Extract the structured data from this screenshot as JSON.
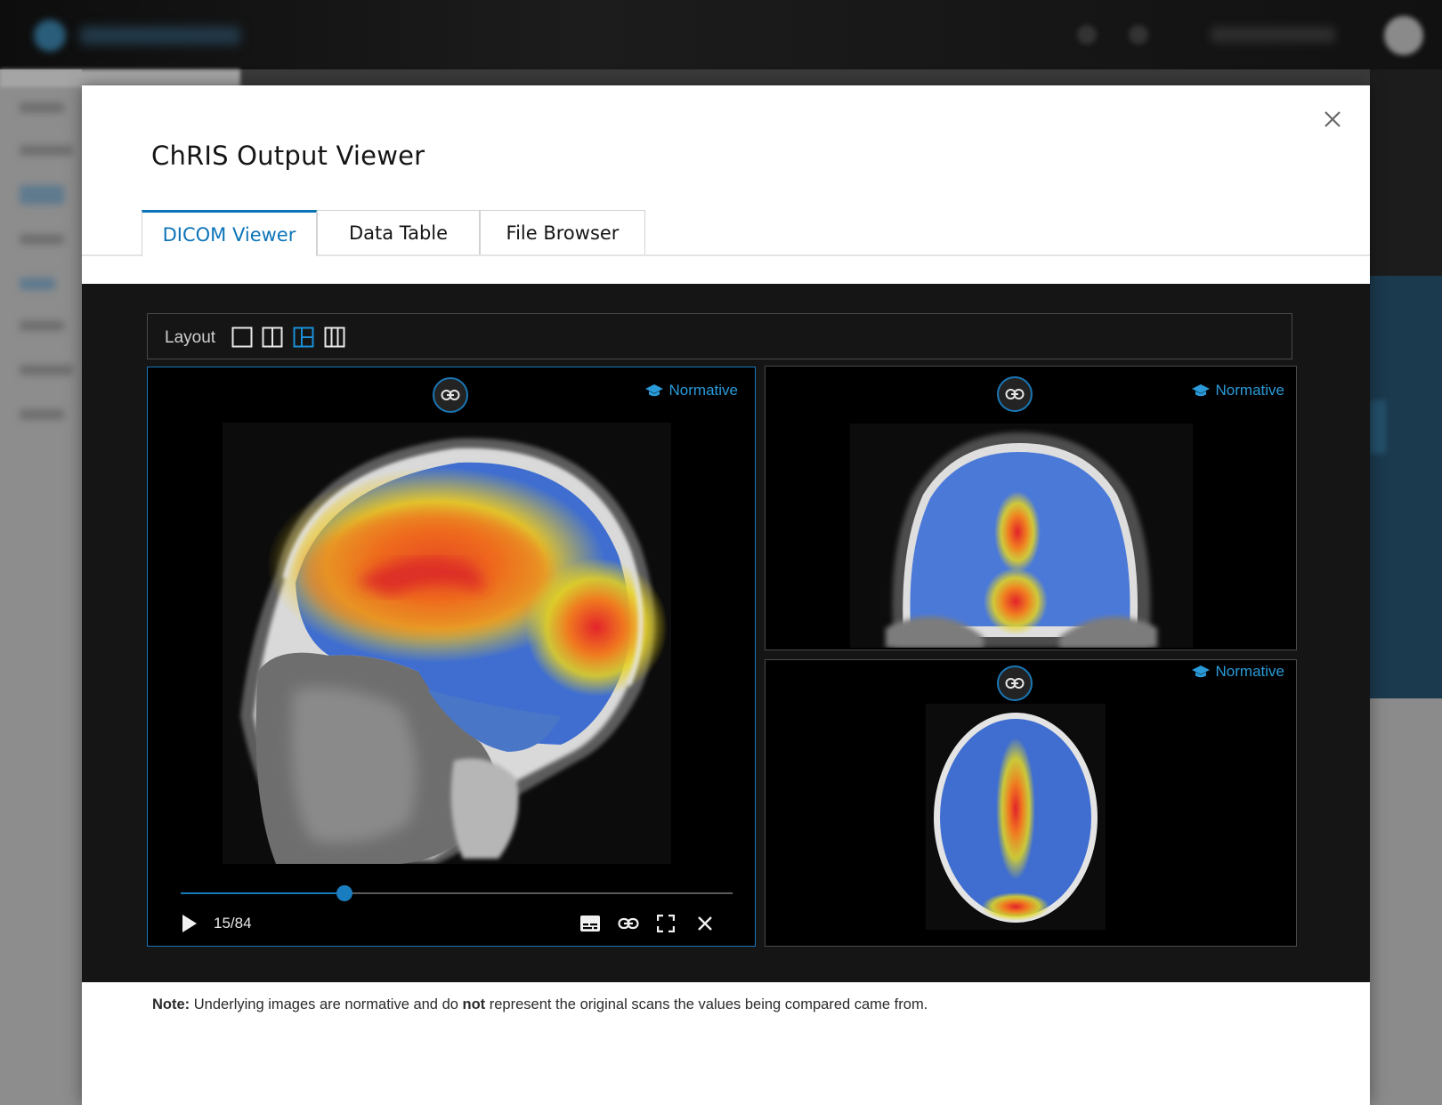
{
  "modal": {
    "title": "ChRIS Output Viewer",
    "close_icon": "close-icon"
  },
  "tabs": [
    {
      "label": "DICOM Viewer",
      "active": true
    },
    {
      "label": "Data Table",
      "active": false
    },
    {
      "label": "File Browser",
      "active": false
    }
  ],
  "layout": {
    "label": "Layout",
    "options": [
      "single-pane-icon",
      "two-column-icon",
      "one-plus-two-icon",
      "three-column-icon"
    ],
    "selected_option": "one-plus-two-icon"
  },
  "panels": [
    {
      "view": "sagittal",
      "badge": "Normative",
      "selected": true
    },
    {
      "view": "coronal",
      "badge": "Normative",
      "selected": false
    },
    {
      "view": "axial",
      "badge": "Normative",
      "selected": false
    }
  ],
  "player": {
    "frame_text": "15/84",
    "progress": 0.296,
    "controls": [
      "play-icon",
      "captions-icon",
      "link-icon",
      "fullscreen-icon",
      "close-icon"
    ]
  },
  "note": {
    "label": "Note:",
    "text_before": " Underlying images are normative and do ",
    "emphasis": "not",
    "text_after": " represent the original scans the values being compared came from."
  },
  "colors": {
    "accent": "#0d74b8",
    "badge": "#2b9ad8",
    "viewer_bg": "#151515"
  }
}
